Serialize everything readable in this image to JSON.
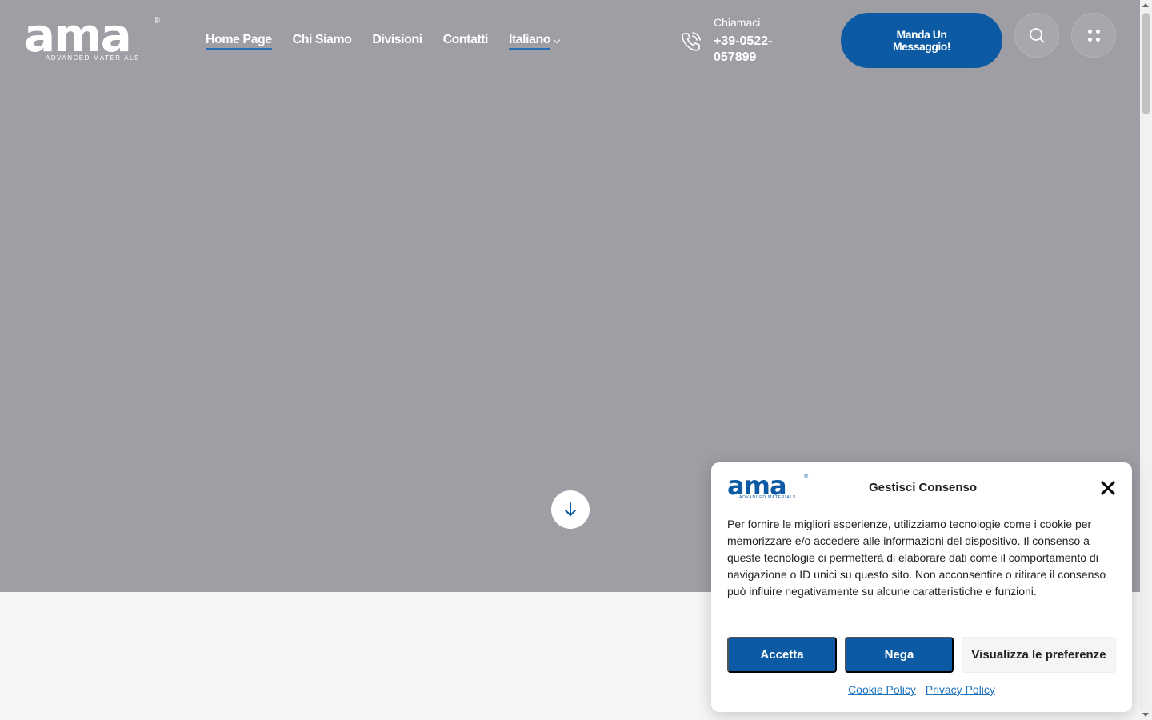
{
  "header": {
    "logo_text": "ama",
    "logo_reg": "®",
    "logo_sub": "ADVANCED MATERIALS",
    "nav": [
      {
        "label": "Home Page"
      },
      {
        "label": "Chi Siamo"
      },
      {
        "label": "Divisioni"
      },
      {
        "label": "Contatti"
      },
      {
        "label": "Italiano"
      }
    ],
    "phone_label": "Chiamaci",
    "phone_number": "+39-0522-057899",
    "cta_label": "Manda Un Messaggio!"
  },
  "consent": {
    "logo_text": "ama",
    "logo_reg": "®",
    "logo_sub": "ADVANCED MATERIALS",
    "title": "Gestisci Consenso",
    "body": "Per fornire le migliori esperienze, utilizziamo tecnologie come i cookie per memorizzare e/o accedere alle informazioni del dispositivo. Il consenso a queste tecnologie ci permetterà di elaborare dati come il comportamento di navigazione o ID unici su questo sito. Non acconsentire o ritirare il consenso può influire negativamente su alcune caratteristiche e funzioni.",
    "accept_label": "Accetta",
    "deny_label": "Nega",
    "prefs_label": "Visualizza le preferenze",
    "cookie_policy": "Cookie Policy",
    "privacy_policy": "Privacy Policy"
  },
  "colors": {
    "brand_blue": "#0b5aa3",
    "hero_gray": "#9e9ea4",
    "link_blue": "#1e73be"
  },
  "icons": [
    "phone-icon",
    "search-icon",
    "menu-dots-icon",
    "arrow-down-icon",
    "close-icon",
    "chevron-down-icon"
  ]
}
